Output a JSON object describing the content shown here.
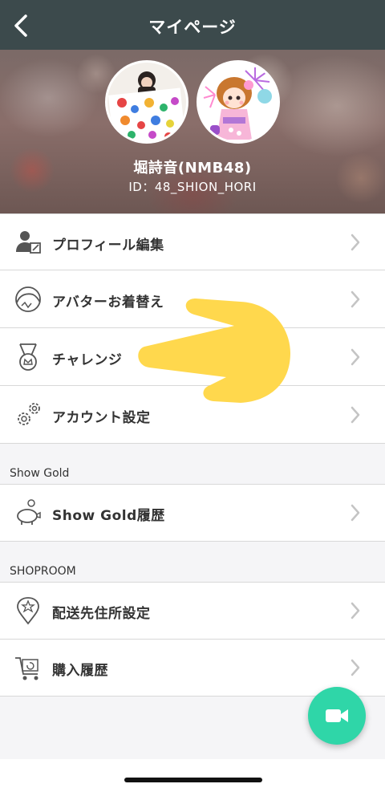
{
  "navbar": {
    "title": "マイページ",
    "back_icon": "chevron-left-icon"
  },
  "profile": {
    "name": "堀詩音(NMB48)",
    "id": "ID：48_SHION_HORI"
  },
  "menu_main": [
    {
      "label": "プロフィール編集",
      "icon": "profile-edit-icon"
    },
    {
      "label": "アバターお着替え",
      "icon": "avatar-icon"
    },
    {
      "label": "チャレンジ",
      "icon": "medal-icon"
    },
    {
      "label": "アカウント設定",
      "icon": "gears-icon"
    }
  ],
  "sections": {
    "show_gold": {
      "label": "Show Gold",
      "items": [
        {
          "label": "Show Gold履歴",
          "icon": "piggy-bank-icon"
        }
      ]
    },
    "shoproom": {
      "label": "SHOPROOM",
      "items": [
        {
          "label": "配送先住所設定",
          "icon": "location-pin-icon"
        },
        {
          "label": "購入履歴",
          "icon": "cart-icon"
        }
      ]
    }
  },
  "fab": {
    "icon": "video-camera-icon"
  },
  "colors": {
    "navbar": "#3c4a4c",
    "fab": "#2fd6a8",
    "pointer": "#ffd84d",
    "section_bg": "#f5f5f7"
  }
}
